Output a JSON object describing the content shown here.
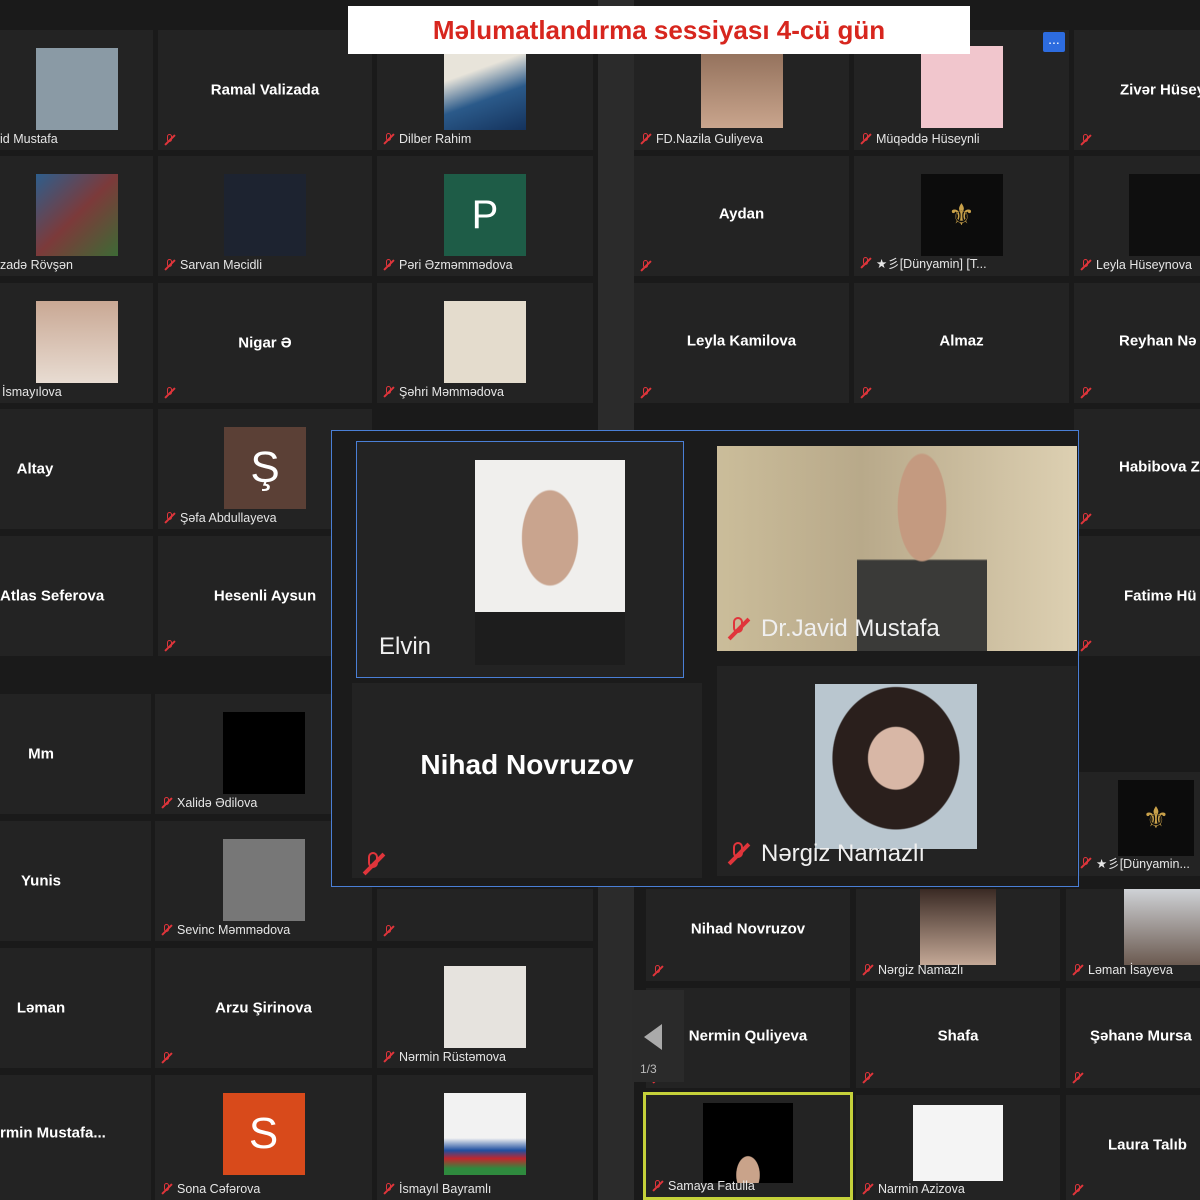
{
  "title": "Məlumatlandırma sessiyası 4-cü gün",
  "more_button": "...",
  "page_indicator": "1/3",
  "colors": {
    "title_red": "#d7261e",
    "mute_red": "#e0353b",
    "active_border": "#c5d13a",
    "overlay_border": "#4a7fd6"
  },
  "tiles": {
    "t1": "id Mustafa",
    "t2": "Ramal Valizada",
    "t3": "Dilber Rahim",
    "t4": "FD.Nazila Guliyeva",
    "t5": "Müqəddə Hüseynli",
    "t6": "Zivər Hüsey",
    "t7": "zadə Rövşən",
    "t8": "Sarvan Məcidli",
    "t9": "Pəri Əzməmmədova",
    "t9_avatar": "P",
    "t10": "Aydan",
    "t11": "★彡[Dünyamin] [T...",
    "t12": "Leyla Hüseynova",
    "t13": "İsmayılova",
    "t14": "Nigar Ə",
    "t15": "Şəhri Məmmədova",
    "t16": "Leyla Kamilova",
    "t17": "Almaz",
    "t18": "Reyhan Nə",
    "t19": "Altay",
    "t20": "Şəfa Abdullayeva",
    "t20_avatar": "Ş",
    "t21": "Habibova Z",
    "t22": "Atlas Seferova",
    "t23": "Hesenli Aysun",
    "t24": "Fatimə Hü",
    "t25": "Mm",
    "t26": "Xalidə Ədilova",
    "t27": "★彡[Dünyamin...",
    "t28": "Yunis",
    "t29": "Sevinc Məmmədova",
    "t30": "Nihad Novruzov",
    "t31": "Nərgiz Namazlı",
    "t32": "Ləman İsayeva",
    "t33": "Ləman",
    "t34": "Arzu Şirinova",
    "t35": "Nərmin Rüstəmova",
    "t36": "Nermin Quliyeva",
    "t37": "Shafa",
    "t38": "Şəhanə  Mursa",
    "t39": "rmin  Mustafa...",
    "t40": "Sona Cəfərova",
    "t40_avatar": "S",
    "t41": "İsmayıl Bayramlı",
    "t42": "Samaya Fatulla",
    "t43": "Narmin Azizova",
    "t44": "Laura Talıb"
  },
  "spotlight": {
    "elvin": "Elvin",
    "javid": "Dr.Javid Mustafa",
    "nihad": "Nihad Novruzov",
    "nargiz": "Nərgiz Namazlı"
  }
}
